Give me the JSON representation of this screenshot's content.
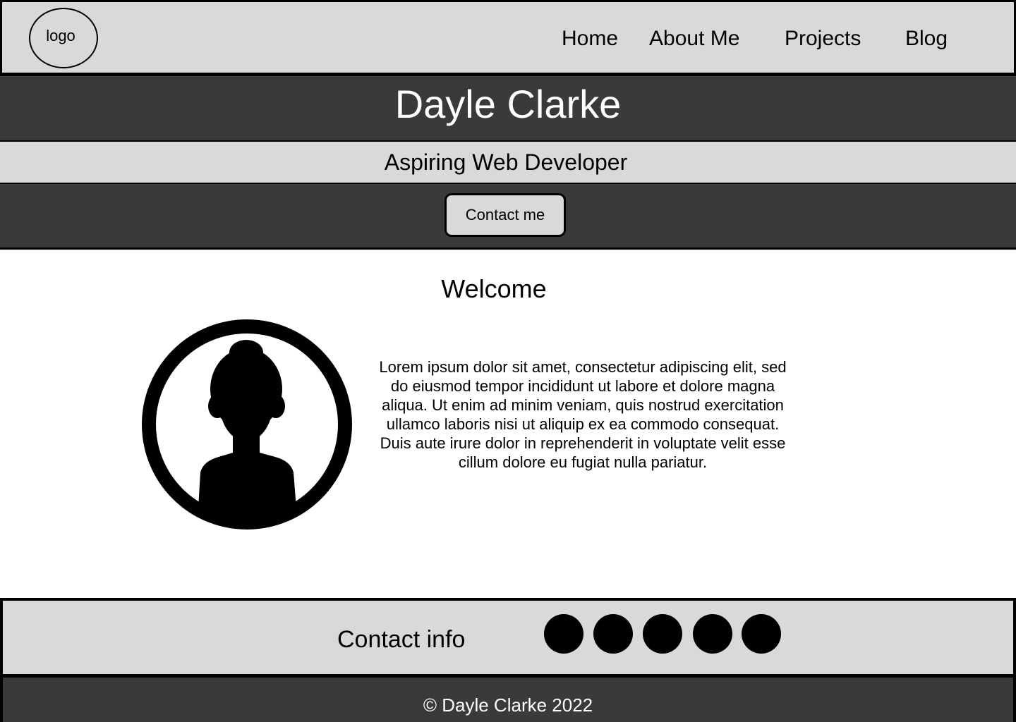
{
  "nav": {
    "logo_label": "logo",
    "links": [
      "Home",
      "About Me",
      "Projects",
      "Blog"
    ]
  },
  "hero": {
    "name": "Dayle Clarke",
    "subtitle": "Aspiring Web Developer",
    "cta_label": "Contact me"
  },
  "welcome": {
    "title": "Welcome",
    "avatar_icon": "person-avatar-icon",
    "body": "Lorem ipsum dolor sit amet, consectetur adipiscing elit, sed do eiusmod tempor incididunt ut labore et dolore magna aliqua. Ut enim ad minim veniam, quis nostrud exercitation ullamco laboris nisi ut aliquip ex ea commodo consequat. Duis aute irure dolor in reprehenderit in voluptate velit esse cillum dolore eu fugiat nulla pariatur."
  },
  "contact": {
    "label": "Contact info",
    "social_icons": [
      "social-icon",
      "social-icon",
      "social-icon",
      "social-icon",
      "social-icon"
    ]
  },
  "footer": {
    "copyright": "© Dayle Clarke 2022"
  },
  "colors": {
    "light_band": "#d9d9d9",
    "dark_band": "#3a3a3a",
    "outline": "#000000"
  }
}
